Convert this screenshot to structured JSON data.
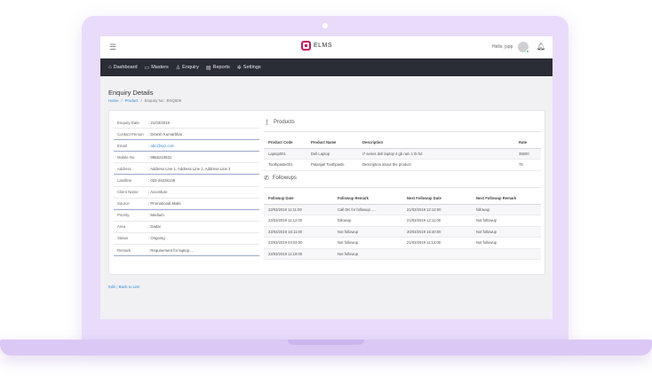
{
  "app": {
    "name": "ELMS",
    "hello": "Hello, jspp"
  },
  "nav": [
    {
      "icon": "home-icon",
      "glyph": "⌂",
      "label": "Dashboard"
    },
    {
      "icon": "monitor-icon",
      "glyph": "▭",
      "label": "Masters"
    },
    {
      "icon": "user-icon",
      "glyph": "♙",
      "label": "Enquiry"
    },
    {
      "icon": "report-icon",
      "glyph": "▤",
      "label": "Reports"
    },
    {
      "icon": "gear-icon",
      "glyph": "✲",
      "label": "Settings"
    }
  ],
  "page": {
    "title": "Enquiry Details",
    "crumbs": [
      "Home",
      "/",
      "Product",
      "/",
      "Enquiry No : ENQ009"
    ]
  },
  "info": [
    {
      "k": "Enquiry Date",
      "v": ": 21/03/2019"
    },
    {
      "k": "Contact Person",
      "v": ": Dinesh Kumarbhai"
    },
    {
      "k": "Email",
      "v": ": abc@xyz.com"
    },
    {
      "k": "Mobile No",
      "v": ": 9865210831"
    },
    {
      "k": "Address",
      "v": ": Address Line 1, Address Line 2, Address Line 3"
    },
    {
      "k": "Landline",
      "v": ": 022-26236136"
    },
    {
      "k": "Client Name",
      "v": ": Accenture"
    },
    {
      "k": "Source",
      "v": ": Promotional Mails"
    },
    {
      "k": "Priority",
      "v": ": Medium"
    },
    {
      "k": "Area",
      "v": ": Dadar"
    },
    {
      "k": "Status",
      "v": ": Ongoing"
    },
    {
      "k": "Remark",
      "v": ": Requirement for laptop...."
    }
  ],
  "products": {
    "title": "Products",
    "headers": [
      "Product Code",
      "Product Name",
      "Description",
      "Rate"
    ],
    "rows": [
      [
        "Laptop001",
        "Dell Laptop",
        "i7 series dell laptop 4 gb ram 1 tb hd",
        "35000"
      ],
      [
        "Toothpaste001",
        "Patanjali Toothpaste",
        "Description about the product",
        "75"
      ]
    ]
  },
  "followups": {
    "title": "Followups",
    "headers": [
      "Followup Date",
      "Followup Remark",
      "Next Followup Date",
      "Next Followup Remark"
    ],
    "rows": [
      [
        "23/03/2019 11:11:00",
        "Call DK for followup ....",
        "21/03/2019 12:12:00",
        "followup"
      ],
      [
        "23/03/2019 11:12:00",
        "followup",
        "21/03/2019 12:11:00",
        "Not followup"
      ],
      [
        "23/03/2019 16:11:00",
        "Not followup",
        "20/03/2019 16:40:00",
        "Not followup"
      ],
      [
        "23/03/2019 04:03:00",
        "Not followup",
        "21/03/2019 11:13:00",
        "Not followup"
      ],
      [
        "23/03/2019 11:19:00",
        "Not followup",
        "",
        ""
      ]
    ]
  },
  "footer": {
    "edit": "Edit",
    "sep": "|",
    "back": "Back to List"
  }
}
